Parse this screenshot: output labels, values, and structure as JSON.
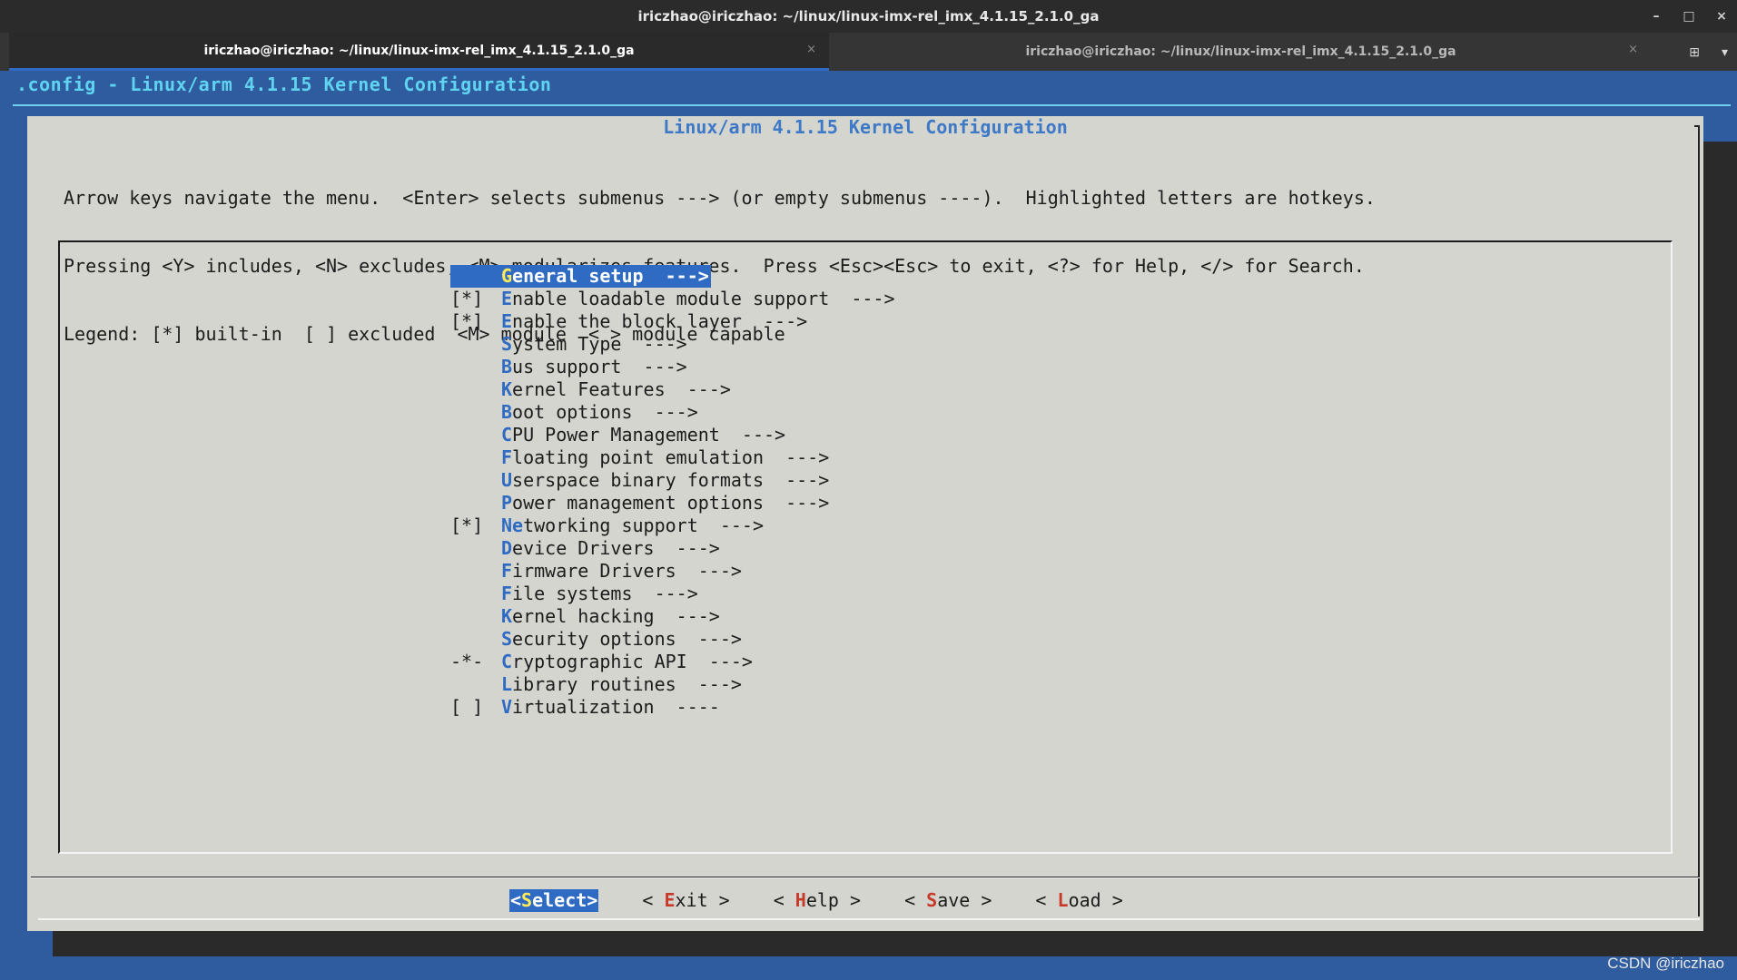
{
  "window": {
    "title": "iriczhao@iriczhao: ~/linux/linux-imx-rel_imx_4.1.15_2.1.0_ga",
    "controls": {
      "minimize": "–",
      "maximize": "□",
      "close": "×"
    }
  },
  "tabs": [
    {
      "label": "iriczhao@iriczhao: ~/linux/linux-imx-rel_imx_4.1.15_2.1.0_ga",
      "close": "×",
      "active": true
    },
    {
      "label": "iriczhao@iriczhao: ~/linux/linux-imx-rel_imx_4.1.15_2.1.0_ga",
      "close": "×",
      "active": false
    }
  ],
  "tab_actions": {
    "new_tab_icon": "new-tab-icon",
    "new_tab_glyph": "⊞",
    "menu_glyph": "▾"
  },
  "terminal": {
    "header": ".config - Linux/arm 4.1.15 Kernel Configuration",
    "dialog_title": "Linux/arm 4.1.15 Kernel Configuration",
    "help_lines": [
      "Arrow keys navigate the menu.  <Enter> selects submenus ---> (or empty submenus ----).  Highlighted letters are hotkeys.",
      "Pressing <Y> includes, <N> excludes, <M> modularizes features.  Press <Esc><Esc> to exit, <?> for Help, </> for Search.",
      "Legend: [*] built-in  [ ] excluded  <M> module  < > module capable"
    ],
    "menu_items": [
      {
        "mark": "",
        "hot": "G",
        "rest": "eneral setup  --->",
        "selected": true
      },
      {
        "mark": "[*]",
        "hot": "E",
        "rest": "nable loadable module support  --->"
      },
      {
        "mark": "[*]",
        "hot": "E",
        "rest": "nable the block layer  --->"
      },
      {
        "mark": "",
        "hot": "S",
        "rest": "ystem Type  --->"
      },
      {
        "mark": "",
        "hot": "B",
        "rest": "us support  --->"
      },
      {
        "mark": "",
        "hot": "K",
        "rest": "ernel Features  --->"
      },
      {
        "mark": "",
        "hot": "B",
        "rest": "oot options  --->"
      },
      {
        "mark": "",
        "hot": "C",
        "rest": "PU Power Management  --->"
      },
      {
        "mark": "",
        "hot": "F",
        "rest": "loating point emulation  --->"
      },
      {
        "mark": "",
        "hot": "U",
        "rest": "serspace binary formats  --->"
      },
      {
        "mark": "",
        "hot": "P",
        "rest": "ower management options  --->"
      },
      {
        "mark": "[*]",
        "hot": "Ne",
        "rest": "tworking support  --->"
      },
      {
        "mark": "",
        "hot": "D",
        "rest": "evice Drivers  --->"
      },
      {
        "mark": "",
        "hot": "F",
        "rest": "irmware Drivers  --->"
      },
      {
        "mark": "",
        "hot": "F",
        "rest": "ile systems  --->"
      },
      {
        "mark": "",
        "hot": "K",
        "rest": "ernel hacking  --->"
      },
      {
        "mark": "",
        "hot": "S",
        "rest": "ecurity options  --->"
      },
      {
        "mark": "-*-",
        "hot": "C",
        "rest": "ryptographic API  --->"
      },
      {
        "mark": "",
        "hot": "L",
        "rest": "ibrary routines  --->"
      },
      {
        "mark": "[ ]",
        "hot": "V",
        "rest": "irtualization  ----"
      }
    ],
    "buttons": [
      {
        "pre": "<",
        "hot": "S",
        "post": "elect>",
        "selected": true
      },
      {
        "pre": "< ",
        "hot": "E",
        "post": "xit >"
      },
      {
        "pre": "< ",
        "hot": "H",
        "post": "elp >"
      },
      {
        "pre": "< ",
        "hot": "S",
        "post": "ave >"
      },
      {
        "pre": "< ",
        "hot": "L",
        "post": "oad >"
      }
    ]
  },
  "watermark": "CSDN @iriczhao",
  "colors": {
    "terminal_bg": "#2f5c9e",
    "dialog_bg": "#d5d5cf",
    "highlight": "#2f6bc2",
    "hotkey_menu": "#2f6bc2",
    "hotkey_button": "#c73a2a",
    "header_text": "#5fd3f0"
  }
}
